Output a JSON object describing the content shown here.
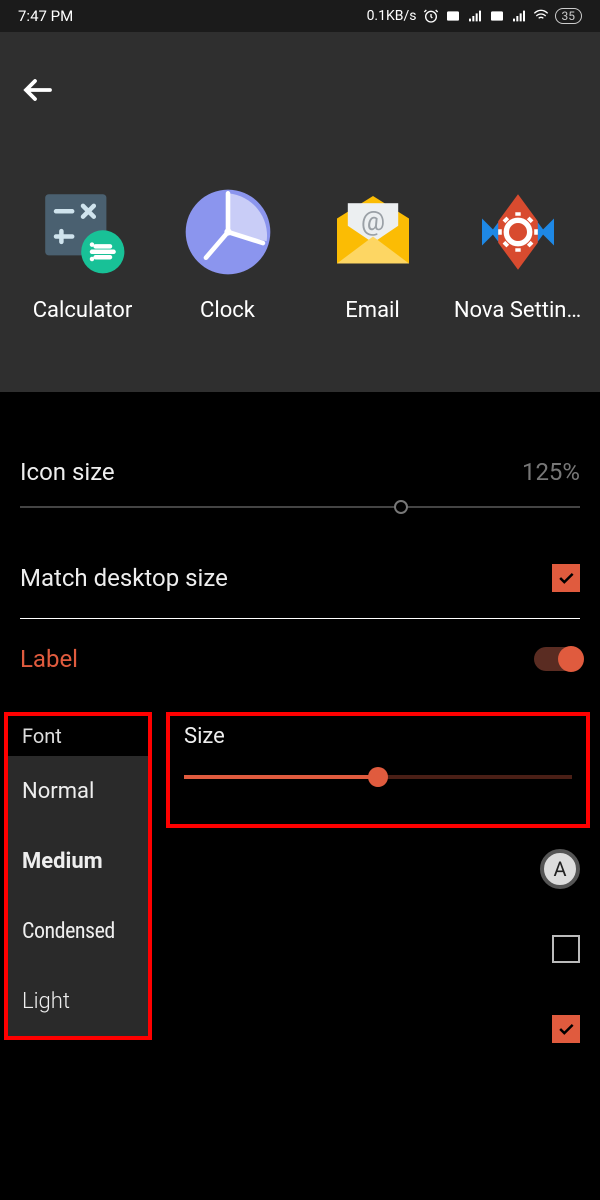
{
  "status_bar": {
    "time": "7:47 PM",
    "net_speed": "0.1KB/s",
    "battery": "35"
  },
  "preview": {
    "apps": [
      {
        "label": "Calculator"
      },
      {
        "label": "Clock"
      },
      {
        "label": "Email"
      },
      {
        "label": "Nova Settin…"
      }
    ]
  },
  "settings": {
    "icon_size": {
      "label": "Icon size",
      "value": "125%",
      "pos_pct": 68
    },
    "match_desktop": {
      "label": "Match desktop size",
      "checked": true
    },
    "label_section": {
      "label": "Label",
      "enabled": true
    },
    "font": {
      "header": "Font",
      "options": [
        "Normal",
        "Medium",
        "Condensed",
        "Light"
      ]
    },
    "size": {
      "header": "Size",
      "pos_pct": 50
    },
    "color_button_glyph": "A",
    "row_unchecked": false,
    "row_checked": true
  }
}
